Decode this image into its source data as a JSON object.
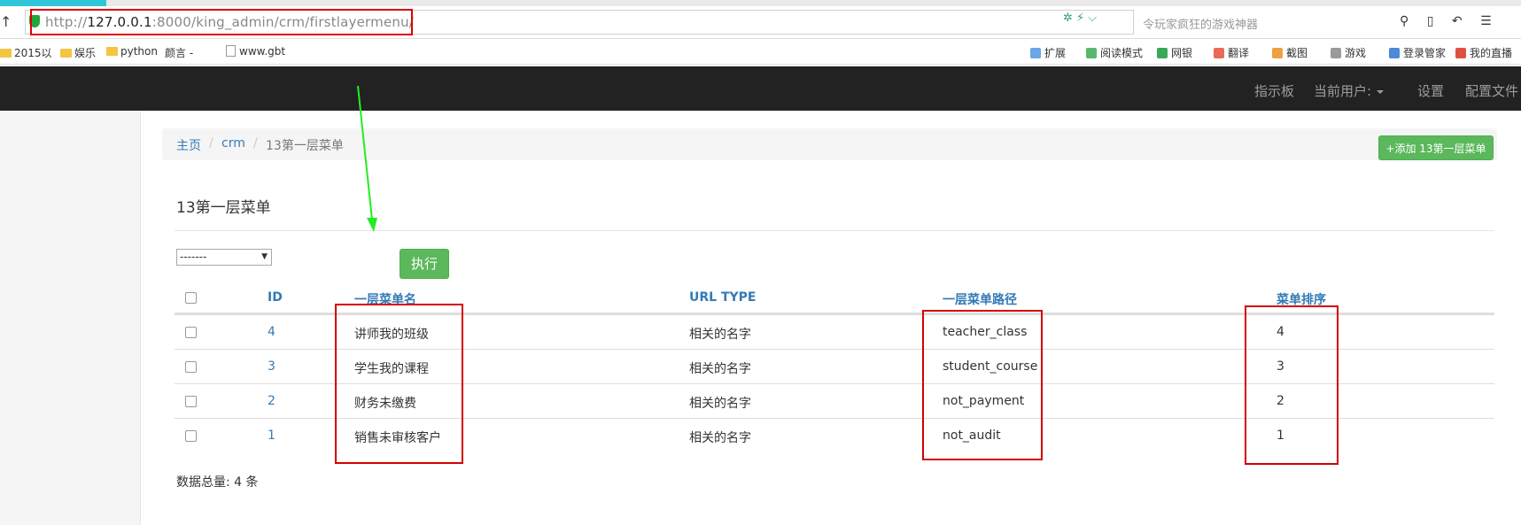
{
  "browser": {
    "url_prefix": "http://",
    "url_host": "127.0.0.1",
    "url_rest": ":8000/king_admin/crm/firstlayermenu/",
    "search_hint": "令玩家疯狂的游戏神器",
    "bookmarks": [
      "2015以",
      "娱乐",
      "python",
      "颜言 -",
      "www.gbt"
    ],
    "toolbar_items": [
      "扩展",
      "阅读模式",
      "网银",
      "翻译",
      "截图",
      "游戏",
      "登录管家",
      "我的直播"
    ]
  },
  "navbar": {
    "dashboard": "指示板",
    "current_user": "当前用户:",
    "settings": "设置",
    "profile": "配置文件"
  },
  "breadcrumb": {
    "home": "主页",
    "app": "crm",
    "current": "13第一层菜单",
    "sep": "/"
  },
  "add_button": "+添加 13第一层菜单",
  "page_title": "13第一层菜单",
  "action": {
    "select_value": "-------",
    "run_label": "执行"
  },
  "table": {
    "headers": [
      "ID",
      "一层菜单名",
      "URL TYPE",
      "一层菜单路径",
      "菜单排序"
    ],
    "rows": [
      {
        "id": "4",
        "name": "讲师我的班级",
        "url_type": "相关的名字",
        "path": "teacher_class",
        "order": "4"
      },
      {
        "id": "3",
        "name": "学生我的课程",
        "url_type": "相关的名字",
        "path": "student_course",
        "order": "3"
      },
      {
        "id": "2",
        "name": "财务未缴费",
        "url_type": "相关的名字",
        "path": "not_payment",
        "order": "2"
      },
      {
        "id": "1",
        "name": "销售未审核客户",
        "url_type": "相关的名字",
        "path": "not_audit",
        "order": "1"
      }
    ]
  },
  "total_text": "数据总量: 4 条",
  "colors": {
    "navbar": "#222222",
    "link": "#337ab7",
    "success": "#5cb85c",
    "annotation_red": "#d40000",
    "annotation_green": "#22ee22"
  }
}
